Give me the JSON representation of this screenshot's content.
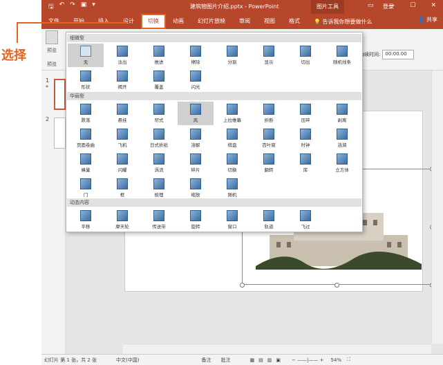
{
  "annotation": {
    "label": "选择"
  },
  "titlebar": {
    "qat_icons": [
      "save-icon",
      "undo-icon",
      "redo-icon",
      "present-icon",
      "more-icon"
    ],
    "doc_title": "建筑物图片介绍.pptx - PowerPoint",
    "context_tab": "图片工具",
    "login": "登录",
    "win_controls": [
      "▭",
      "—",
      "☐",
      "✕"
    ]
  },
  "ribbon": {
    "tabs": [
      "文件",
      "开始",
      "插入",
      "设计",
      "切换",
      "动画",
      "幻灯片放映",
      "审阅",
      "视图",
      "格式"
    ],
    "active": "切换",
    "search_hint": "告诉我你想要做什么",
    "share": "共享",
    "preview_label": "预览",
    "preview_group": "预览",
    "timing_label": "持续时间:",
    "timing_value": "00:00.00"
  },
  "slides_panel": {
    "slide1_num": "1",
    "slide1_star": "*",
    "slide2_num": "2"
  },
  "gallery": {
    "cat_subtle": "细微型",
    "cat_exciting": "华丽型",
    "cat_dynamic": "动态内容",
    "subtle": [
      "无",
      "淡出",
      "推进",
      "擦除",
      "分割",
      "显示",
      "切出",
      "随机线条",
      "形状",
      "揭开",
      "覆盖",
      "闪光"
    ],
    "exciting": [
      "跌落",
      "悬挂",
      "帘式",
      "风",
      "上拉帷幕",
      "折断",
      "压碎",
      "剥离",
      "页面卷曲",
      "飞机",
      "日式折纸",
      "溶解",
      "棋盘",
      "百叶窗",
      "时钟",
      "涟漪",
      "蜂巢",
      "闪耀",
      "涡流",
      "碎片",
      "切换",
      "翻转",
      "库",
      "立方体",
      "门",
      "框",
      "梳理",
      "缩放",
      "随机"
    ],
    "dynamic": [
      "平移",
      "摩天轮",
      "传送带",
      "旋转",
      "窗口",
      "轨道",
      "飞过"
    ]
  },
  "status": {
    "slide_info": "幻灯片 第 1 张，共 2 张",
    "lang": "中文(中国)",
    "notes": "备注",
    "comments": "批注",
    "zoom": "54%"
  }
}
